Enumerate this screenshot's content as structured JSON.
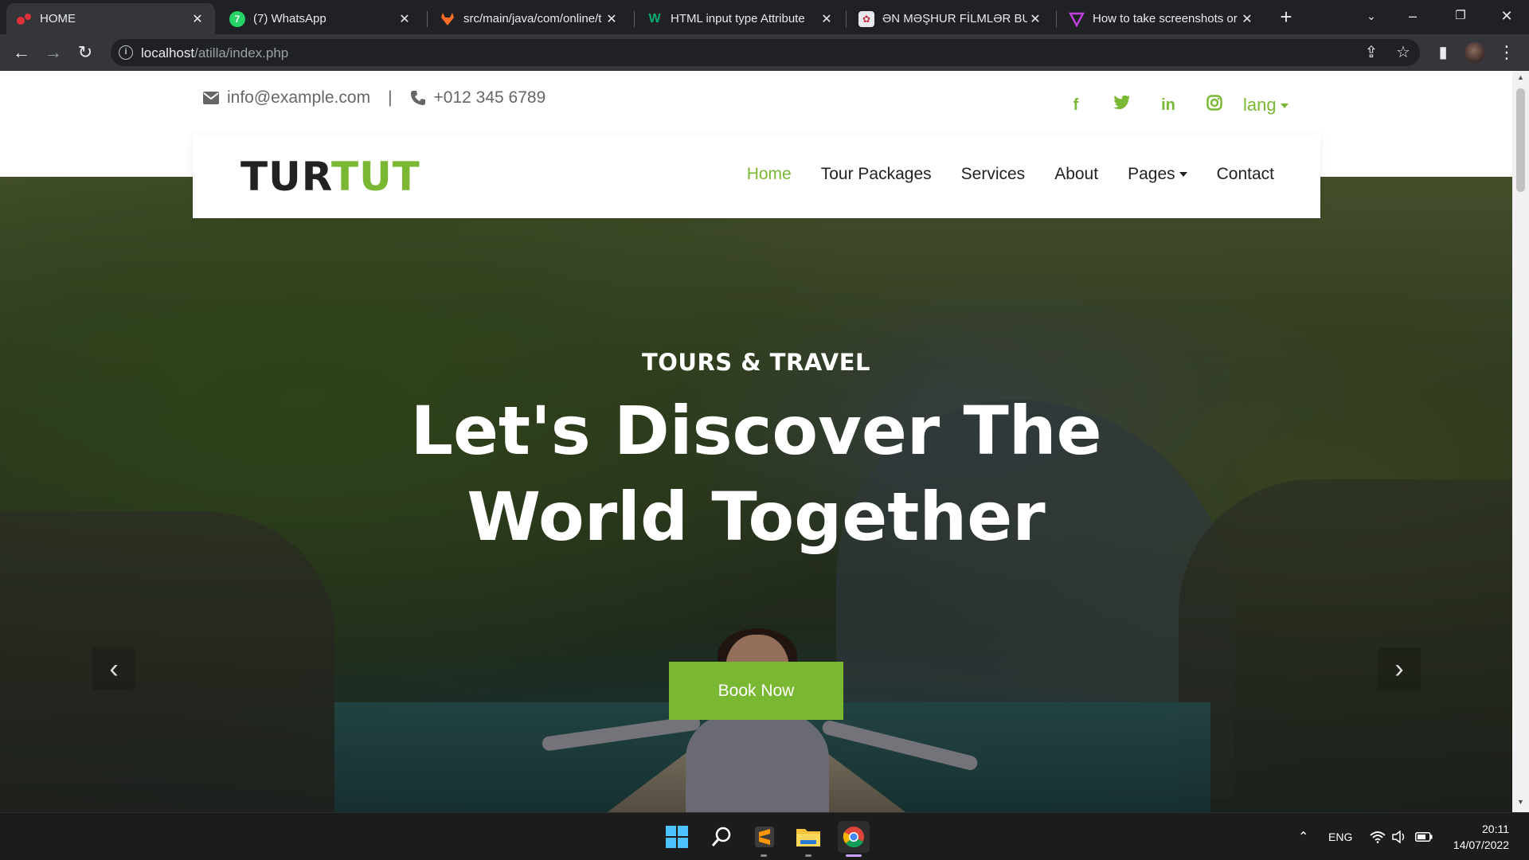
{
  "browser": {
    "tabs": [
      {
        "title": "HOME",
        "active": true,
        "icon": "site-favicon"
      },
      {
        "title": "(7) WhatsApp",
        "active": false,
        "icon": "whatsapp-icon"
      },
      {
        "title": "src/main/java/com/online/t",
        "active": false,
        "icon": "gitlab-icon"
      },
      {
        "title": "HTML input type Attribute",
        "active": false,
        "icon": "w3schools-icon"
      },
      {
        "title": "ƏN MƏŞHUR FİLMLƏR BUR",
        "active": false,
        "icon": "film-icon"
      },
      {
        "title": "How to take screenshots or",
        "active": false,
        "icon": "vector-icon"
      }
    ],
    "url_host": "localhost",
    "url_path": "/atilla/index.php"
  },
  "site": {
    "contact": {
      "email": "info@example.com",
      "separator": "|",
      "phone": "+012 345 6789"
    },
    "socials": [
      "f",
      "twitter",
      "in",
      "instagram"
    ],
    "lang_label": "lang",
    "logo": {
      "part1": "TUR",
      "part2": "TUT"
    },
    "nav": [
      "Home",
      "Tour Packages",
      "Services",
      "About",
      "Pages",
      "Contact"
    ],
    "nav_active": "Home",
    "hero": {
      "kicker": "TOURS & TRAVEL",
      "headline_line1": "Let's Discover The",
      "headline_line2": "World Together",
      "cta": "Book Now"
    }
  },
  "taskbar": {
    "language": "ENG",
    "time": "20:11",
    "date": "14/07/2022"
  },
  "colors": {
    "accent": "#7ab733",
    "text_dark": "#222222",
    "browser_bg": "#202124",
    "browser_tab_active": "#35363a"
  }
}
